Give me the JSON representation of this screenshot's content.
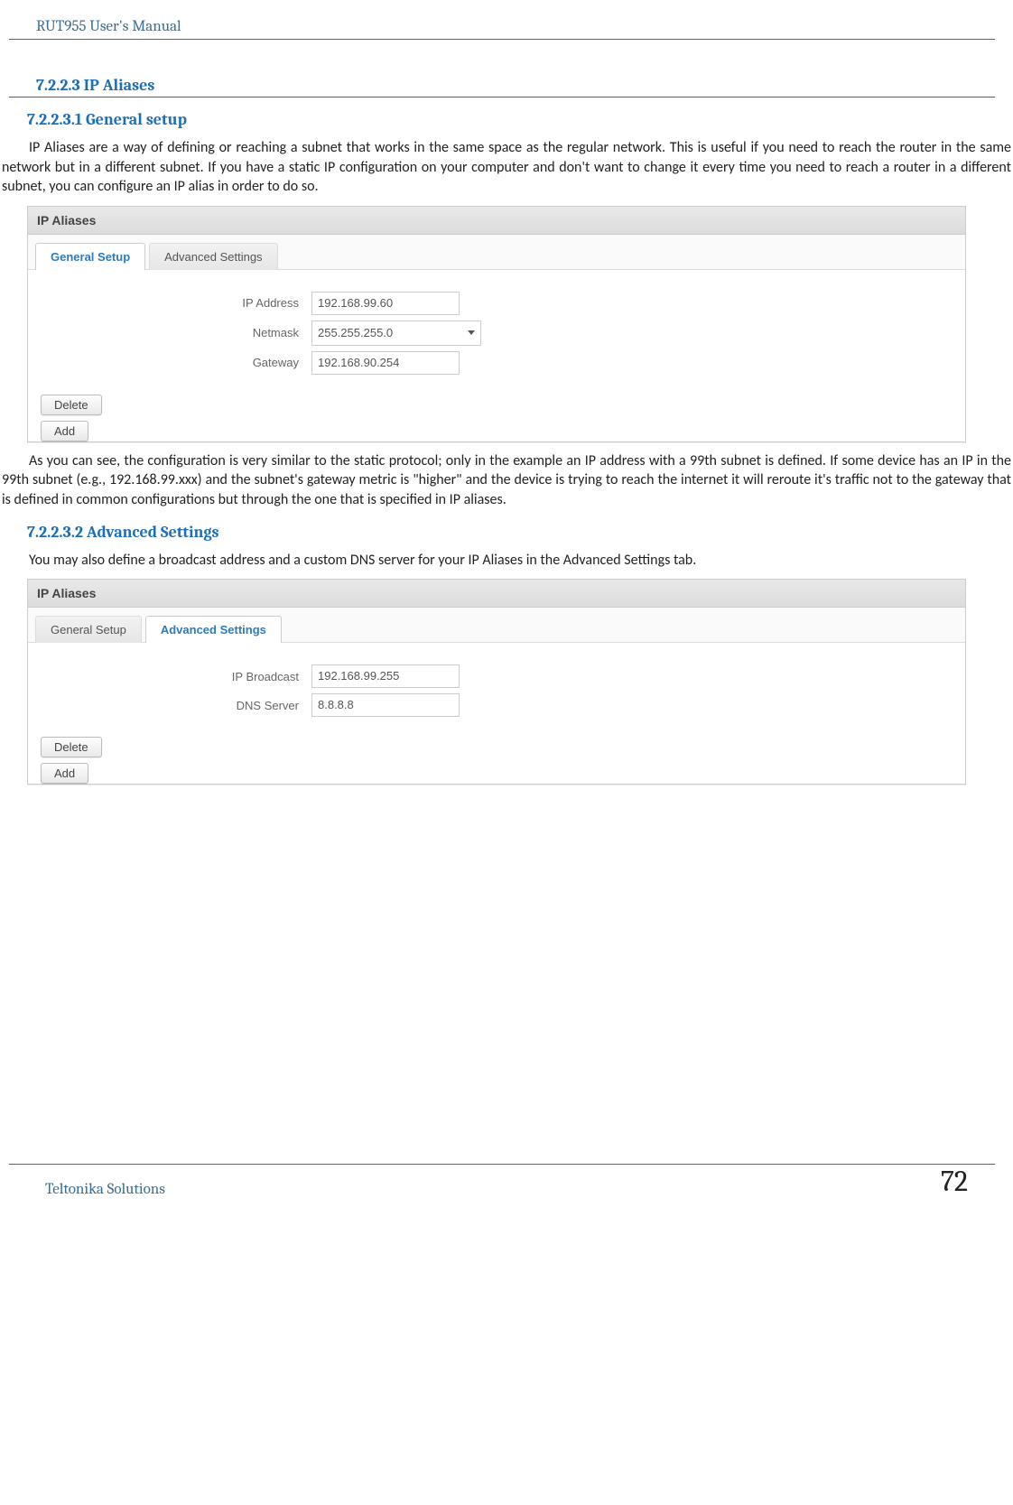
{
  "doc_header": "RUT955 User's Manual",
  "headings": {
    "h3": "7.2.2.3    IP Aliases",
    "h4a": "7.2.2.3.1   General setup",
    "h4b": "7.2.2.3.2   Advanced Settings"
  },
  "paragraphs": {
    "p1": "IP Aliases are a way of defining or reaching a subnet that works in the same space as the regular network. This is useful if you need to reach the router in the same network but in a different subnet. If you have a static IP configuration on your computer and don't want to change it every time you need to reach a router in a different subnet, you can configure an IP alias in order to do so.",
    "p2": "As you can see, the configuration is very similar to the static protocol; only in the example an IP address with a 99th subnet is defined. If some device has an IP in the 99th subnet (e.g., 192.168.99.xxx) and the subnet's gateway metric is \"higher\" and the device is trying to reach the internet it will reroute it's traffic not to the gateway that is defined in common configurations but through the one that is specified in IP aliases.",
    "p3": "You may also define a broadcast address and a custom DNS server for your IP Aliases in the Advanced Settings tab."
  },
  "screenshot1": {
    "title": "IP Aliases",
    "tabs": {
      "general": "General  Setup",
      "advanced": "Advanced  Settings"
    },
    "fields": {
      "ip_label": "IP Address",
      "ip_value": "192.168.99.60",
      "netmask_label": "Netmask",
      "netmask_value": "255.255.255.0",
      "gateway_label": "Gateway",
      "gateway_value": "192.168.90.254"
    },
    "buttons": {
      "delete": "Delete",
      "add": "Add"
    }
  },
  "screenshot2": {
    "title": "IP Aliases",
    "tabs": {
      "general": "General  Setup",
      "advanced": "Advanced  Settings"
    },
    "fields": {
      "broadcast_label": "IP Broadcast",
      "broadcast_value": "192.168.99.255",
      "dns_label": "DNS Server",
      "dns_value": "8.8.8.8"
    },
    "buttons": {
      "delete": "Delete",
      "add": "Add"
    }
  },
  "footer": {
    "left": "Teltonika Solutions",
    "right": "72"
  }
}
